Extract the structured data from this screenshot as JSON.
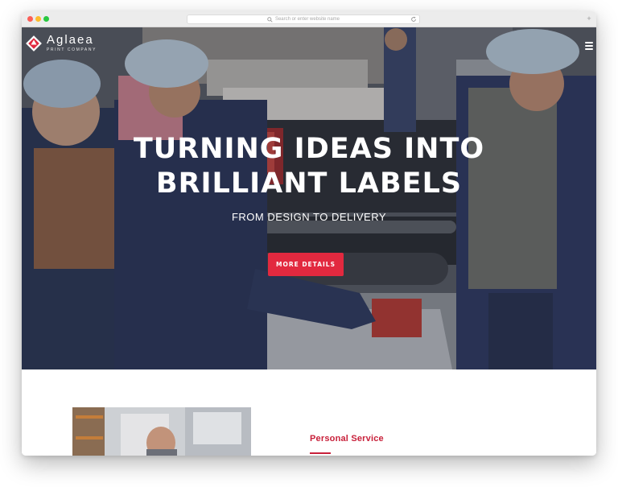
{
  "browser": {
    "address_placeholder": "Search or enter website name",
    "newtab_label": "+"
  },
  "brand": {
    "name": "Aglaea",
    "tagline": "PRINT COMPANY",
    "accent": "#e2293f"
  },
  "hero": {
    "headline_line1": "TURNING IDEAS INTO",
    "headline_line2": "BRILLIANT LABELS",
    "subheadline": "FROM DESIGN TO DELIVERY",
    "cta_label": "MORE DETAILS"
  },
  "services": {
    "title": "Personal Service"
  },
  "icons": {
    "logo": "diamond-logo-icon",
    "menu": "hamburger-menu-icon",
    "search": "search-icon",
    "reload": "reload-icon"
  }
}
